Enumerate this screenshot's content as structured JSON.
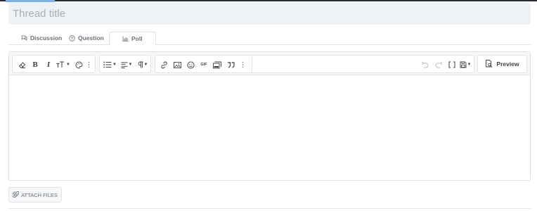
{
  "thread": {
    "title_placeholder": "Thread title",
    "title_value": ""
  },
  "tabs": [
    {
      "label": "Discussion",
      "icon": "chat-icon",
      "active": false
    },
    {
      "label": "Question",
      "icon": "question-circle-icon",
      "active": false
    },
    {
      "label": "Poll",
      "icon": "bar-chart-icon",
      "active": true
    }
  ],
  "toolbar": {
    "groups": [
      [
        "eraser-icon",
        "bold-icon",
        "italic-icon",
        "text-size-icon",
        "palette-icon",
        "more-vertical-icon"
      ],
      [
        "bulleted-list-icon",
        "align-left-icon",
        "paragraph-icon"
      ],
      [
        "link-icon",
        "image-icon",
        "smiley-icon",
        "gif-icon",
        "media-icon",
        "quote-icon",
        "more-vertical-icon"
      ],
      [
        "undo-icon",
        "redo-icon",
        "brackets-icon",
        "save-draft-icon"
      ]
    ],
    "gif_label": "GIF",
    "bold_label": "B",
    "italic_label": "I",
    "preview_label": "Preview"
  },
  "editor": {
    "content": ""
  },
  "attach": {
    "label": "ATTACH FILES"
  },
  "colors": {
    "title_bg": "#eef1f6",
    "toolbar_bg": "#f6f7f9",
    "accent": "#7fb2e0"
  }
}
